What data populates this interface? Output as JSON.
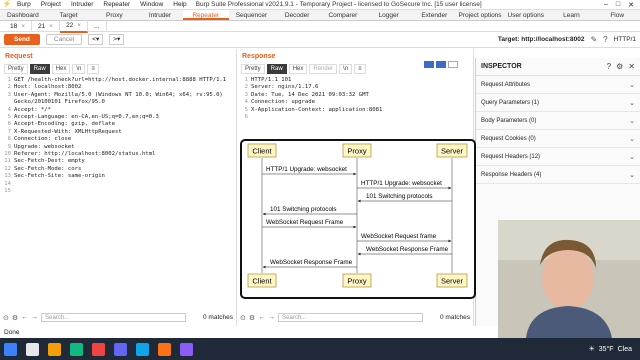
{
  "window": {
    "title": "Burp Suite Professional v2021.9.1 - Temporary Project - licensed to GoSecure Inc. [15 user license]",
    "menus": [
      "Burp",
      "Project",
      "Intruder",
      "Repeater",
      "Window",
      "Help"
    ]
  },
  "tabs": [
    "Dashboard",
    "Target",
    "Proxy",
    "Intruder",
    "Repeater",
    "Sequencer",
    "Decoder",
    "Comparer",
    "Logger",
    "Extender",
    "Project options",
    "User options",
    "Learn",
    "Flow"
  ],
  "active_tab": "Repeater",
  "subtabs": [
    {
      "label": "18",
      "close": "×"
    },
    {
      "label": "21",
      "close": "×"
    },
    {
      "label": "22",
      "close": "×"
    },
    {
      "label": "...",
      "close": ""
    }
  ],
  "toolbar": {
    "send_label": "Send",
    "cancel_label": "Cancel",
    "prev": "<",
    "prev_dd": "▾",
    "next": ">",
    "next_dd": "▾",
    "target_label": "Target: http://localhost:8002",
    "edit_icon": "pencil-icon",
    "help_icon": "question-icon",
    "http_version": "HTTP/1"
  },
  "request": {
    "title": "Request",
    "view_buttons": [
      "Pretty",
      "Raw",
      "Hex",
      "\\n",
      "≡"
    ],
    "active_view": "Raw",
    "lines": [
      "GET /health-check?url=http://host.docker.internal:8888 HTTP/1.1",
      "Host: localhost:8002",
      "User-Agent: Mozilla/5.0 (Windows NT 10.0; Win64; x64; rv:95.0)",
      "Gecko/20100101 Firefox/95.0",
      "Accept: */*",
      "Accept-Language: en-CA,en-US;q=0.7,en;q=0.3",
      "Accept-Encoding: gzip, deflate",
      "X-Requested-With: XMLHttpRequest",
      "Connection: close",
      "Upgrade: websocket",
      "Referer: http://localhost:8002/status.html",
      "Sec-Fetch-Dest: empty",
      "Sec-Fetch-Mode: cors",
      "Sec-Fetch-Site: same-origin",
      "",
      ""
    ],
    "line_numbers": [
      "1",
      "2",
      "3",
      "",
      "4",
      "5",
      "6",
      "7",
      "8",
      "9",
      "10",
      "11",
      "12",
      "13",
      "14",
      "15"
    ],
    "search_placeholder": "Search...",
    "matches": "0 matches"
  },
  "response": {
    "title": "Response",
    "view_buttons": [
      "Pretty",
      "Raw",
      "Hex",
      "Render",
      "\\n",
      "≡"
    ],
    "active_view": "Raw",
    "lines": [
      "HTTP/1.1 101",
      "Server: nginx/1.17.6",
      "Date: Tue, 14 Dec 2021 09:03:32 GMT",
      "Connection: upgrade",
      "X-Application-Context: application:8081",
      ""
    ],
    "line_numbers": [
      "1",
      "2",
      "3",
      "4",
      "5",
      "6"
    ],
    "search_placeholder": "Search...",
    "matches": "0 matches"
  },
  "diagram": {
    "participants": [
      "Client",
      "Proxy",
      "Server"
    ],
    "messages": [
      "HTTP/1 Upgrade: websocket",
      "HTTP/1 Upgrade: websocket",
      "101 Switching protocols",
      "101 Switching protocols",
      "WebSocket Request Frame",
      "WebSocket Request frame",
      "WebSocket Response Frame",
      "WebSocket Response Frame"
    ]
  },
  "inspector": {
    "title": "INSPECTOR",
    "rows": [
      "Request Attributes",
      "Query Parameters (1)",
      "Body Parameters (0)",
      "Request Cookies (0)",
      "Request Headers (12)",
      "Response Headers (4)"
    ]
  },
  "status": "Done",
  "taskbar": {
    "weather": "35°F",
    "weather_text": "Clea"
  }
}
